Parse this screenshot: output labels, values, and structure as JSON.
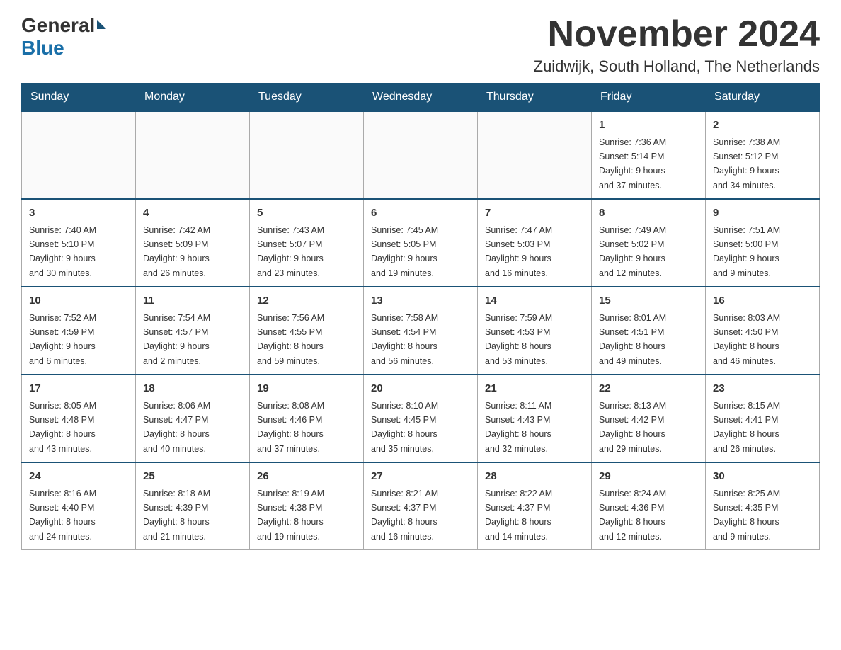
{
  "logo": {
    "general": "General",
    "blue": "Blue",
    "arrow": "▶"
  },
  "header": {
    "month_year": "November 2024",
    "location": "Zuidwijk, South Holland, The Netherlands"
  },
  "weekdays": [
    "Sunday",
    "Monday",
    "Tuesday",
    "Wednesday",
    "Thursday",
    "Friday",
    "Saturday"
  ],
  "weeks": [
    [
      {
        "day": "",
        "info": ""
      },
      {
        "day": "",
        "info": ""
      },
      {
        "day": "",
        "info": ""
      },
      {
        "day": "",
        "info": ""
      },
      {
        "day": "",
        "info": ""
      },
      {
        "day": "1",
        "info": "Sunrise: 7:36 AM\nSunset: 5:14 PM\nDaylight: 9 hours\nand 37 minutes."
      },
      {
        "day": "2",
        "info": "Sunrise: 7:38 AM\nSunset: 5:12 PM\nDaylight: 9 hours\nand 34 minutes."
      }
    ],
    [
      {
        "day": "3",
        "info": "Sunrise: 7:40 AM\nSunset: 5:10 PM\nDaylight: 9 hours\nand 30 minutes."
      },
      {
        "day": "4",
        "info": "Sunrise: 7:42 AM\nSunset: 5:09 PM\nDaylight: 9 hours\nand 26 minutes."
      },
      {
        "day": "5",
        "info": "Sunrise: 7:43 AM\nSunset: 5:07 PM\nDaylight: 9 hours\nand 23 minutes."
      },
      {
        "day": "6",
        "info": "Sunrise: 7:45 AM\nSunset: 5:05 PM\nDaylight: 9 hours\nand 19 minutes."
      },
      {
        "day": "7",
        "info": "Sunrise: 7:47 AM\nSunset: 5:03 PM\nDaylight: 9 hours\nand 16 minutes."
      },
      {
        "day": "8",
        "info": "Sunrise: 7:49 AM\nSunset: 5:02 PM\nDaylight: 9 hours\nand 12 minutes."
      },
      {
        "day": "9",
        "info": "Sunrise: 7:51 AM\nSunset: 5:00 PM\nDaylight: 9 hours\nand 9 minutes."
      }
    ],
    [
      {
        "day": "10",
        "info": "Sunrise: 7:52 AM\nSunset: 4:59 PM\nDaylight: 9 hours\nand 6 minutes."
      },
      {
        "day": "11",
        "info": "Sunrise: 7:54 AM\nSunset: 4:57 PM\nDaylight: 9 hours\nand 2 minutes."
      },
      {
        "day": "12",
        "info": "Sunrise: 7:56 AM\nSunset: 4:55 PM\nDaylight: 8 hours\nand 59 minutes."
      },
      {
        "day": "13",
        "info": "Sunrise: 7:58 AM\nSunset: 4:54 PM\nDaylight: 8 hours\nand 56 minutes."
      },
      {
        "day": "14",
        "info": "Sunrise: 7:59 AM\nSunset: 4:53 PM\nDaylight: 8 hours\nand 53 minutes."
      },
      {
        "day": "15",
        "info": "Sunrise: 8:01 AM\nSunset: 4:51 PM\nDaylight: 8 hours\nand 49 minutes."
      },
      {
        "day": "16",
        "info": "Sunrise: 8:03 AM\nSunset: 4:50 PM\nDaylight: 8 hours\nand 46 minutes."
      }
    ],
    [
      {
        "day": "17",
        "info": "Sunrise: 8:05 AM\nSunset: 4:48 PM\nDaylight: 8 hours\nand 43 minutes."
      },
      {
        "day": "18",
        "info": "Sunrise: 8:06 AM\nSunset: 4:47 PM\nDaylight: 8 hours\nand 40 minutes."
      },
      {
        "day": "19",
        "info": "Sunrise: 8:08 AM\nSunset: 4:46 PM\nDaylight: 8 hours\nand 37 minutes."
      },
      {
        "day": "20",
        "info": "Sunrise: 8:10 AM\nSunset: 4:45 PM\nDaylight: 8 hours\nand 35 minutes."
      },
      {
        "day": "21",
        "info": "Sunrise: 8:11 AM\nSunset: 4:43 PM\nDaylight: 8 hours\nand 32 minutes."
      },
      {
        "day": "22",
        "info": "Sunrise: 8:13 AM\nSunset: 4:42 PM\nDaylight: 8 hours\nand 29 minutes."
      },
      {
        "day": "23",
        "info": "Sunrise: 8:15 AM\nSunset: 4:41 PM\nDaylight: 8 hours\nand 26 minutes."
      }
    ],
    [
      {
        "day": "24",
        "info": "Sunrise: 8:16 AM\nSunset: 4:40 PM\nDaylight: 8 hours\nand 24 minutes."
      },
      {
        "day": "25",
        "info": "Sunrise: 8:18 AM\nSunset: 4:39 PM\nDaylight: 8 hours\nand 21 minutes."
      },
      {
        "day": "26",
        "info": "Sunrise: 8:19 AM\nSunset: 4:38 PM\nDaylight: 8 hours\nand 19 minutes."
      },
      {
        "day": "27",
        "info": "Sunrise: 8:21 AM\nSunset: 4:37 PM\nDaylight: 8 hours\nand 16 minutes."
      },
      {
        "day": "28",
        "info": "Sunrise: 8:22 AM\nSunset: 4:37 PM\nDaylight: 8 hours\nand 14 minutes."
      },
      {
        "day": "29",
        "info": "Sunrise: 8:24 AM\nSunset: 4:36 PM\nDaylight: 8 hours\nand 12 minutes."
      },
      {
        "day": "30",
        "info": "Sunrise: 8:25 AM\nSunset: 4:35 PM\nDaylight: 8 hours\nand 9 minutes."
      }
    ]
  ]
}
